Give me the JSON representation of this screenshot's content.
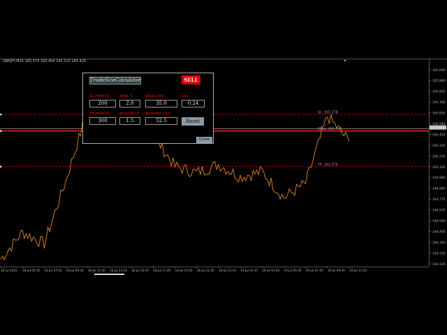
{
  "chart": {
    "symbol_line": "GBPJPY,M15  165.373 165.459 165.315 165.420",
    "price_labels": [
      "165.095",
      "165.880",
      "165.655",
      "165.760",
      "165.655",
      "165.540",
      "165.420",
      "165.325",
      "165.210",
      "165.105",
      "164.995",
      "164.890",
      "164.775",
      "164.670",
      "164.560",
      "164.450",
      "164.340",
      "164.230",
      "164.120"
    ],
    "time_labels": [
      "18 Jul 2022",
      "18 Jul 05:45",
      "18 Jul 07:45",
      "18 Jul 09:45",
      "18 Jul 11:45",
      "18 Jul 13:45",
      "18 Jul 15:45",
      "18 Jul 17:45",
      "18 Jul 19:45",
      "18 Jul 21:45",
      "18 Jul 23:45",
      "19 Jul 01:45",
      "19 Jul 03:45",
      "19 Jul 05:45",
      "19 Jul 07:45",
      "19 Jul 09:45",
      "19 Jul 11:45"
    ],
    "sl_label": "SL: 165.578",
    "entry_label": "SELL: 165.420",
    "tp_label": "TP: 165.078",
    "colors": {
      "price_line": "#e08a1e",
      "sl_line": "#d40000",
      "entry_line": "#ff2020",
      "tp_line": "#d40000"
    }
  },
  "chart_data": {
    "type": "line",
    "x": [
      "18 Jul 2022",
      "18 Jul 05:45",
      "18 Jul 07:45",
      "18 Jul 09:45",
      "18 Jul 11:45",
      "18 Jul 13:45",
      "18 Jul 15:45",
      "18 Jul 17:45",
      "18 Jul 19:45",
      "18 Jul 21:45",
      "18 Jul 23:45",
      "19 Jul 01:45",
      "19 Jul 03:45",
      "19 Jul 05:45",
      "19 Jul 07:45",
      "19 Jul 09:45",
      "19 Jul 11:45"
    ],
    "y": [
      164.19,
      164.45,
      164.34,
      164.95,
      165.63,
      165.73,
      165.62,
      165.38,
      165.08,
      165.02,
      165.1,
      164.98,
      165.03,
      164.78,
      164.92,
      165.56,
      165.32
    ],
    "ylim": [
      164.12,
      166.1
    ],
    "title": "",
    "xlabel": "",
    "ylabel": "",
    "series": [
      {
        "values": [
          164.19,
          164.45,
          164.34,
          164.95,
          165.63,
          165.73,
          165.62,
          165.38,
          165.08,
          165.02,
          165.1,
          164.98,
          165.03,
          164.78,
          164.92,
          165.56,
          165.32
        ]
      }
    ],
    "hlines": [
      {
        "label": "SL: 165.578",
        "value": 165.578
      },
      {
        "label": "SELL: 165.420",
        "value": 165.42
      },
      {
        "label": "TP: 165.078",
        "value": 165.078
      }
    ]
  },
  "panel": {
    "title": "TradeSizeCalculator",
    "sell_label": "SELL",
    "sl_points_label": "SL POINTS",
    "risk_pct_label": "RISK %",
    "risk_usd_label": "RISK USD",
    "lot_label": "LOT",
    "sl_points": "200",
    "risk_pct": "2.0",
    "risk_usd": "35.0",
    "lot": "0.24",
    "tp_points_label": "TP POINTS",
    "reward_r_label": "REWARD R",
    "reward_usd_label": "REWARD USD",
    "tp_points": "300",
    "reward_r": "1.5",
    "reward_usd": "52.5",
    "reset_label": "Reset",
    "close_label": "Close"
  }
}
